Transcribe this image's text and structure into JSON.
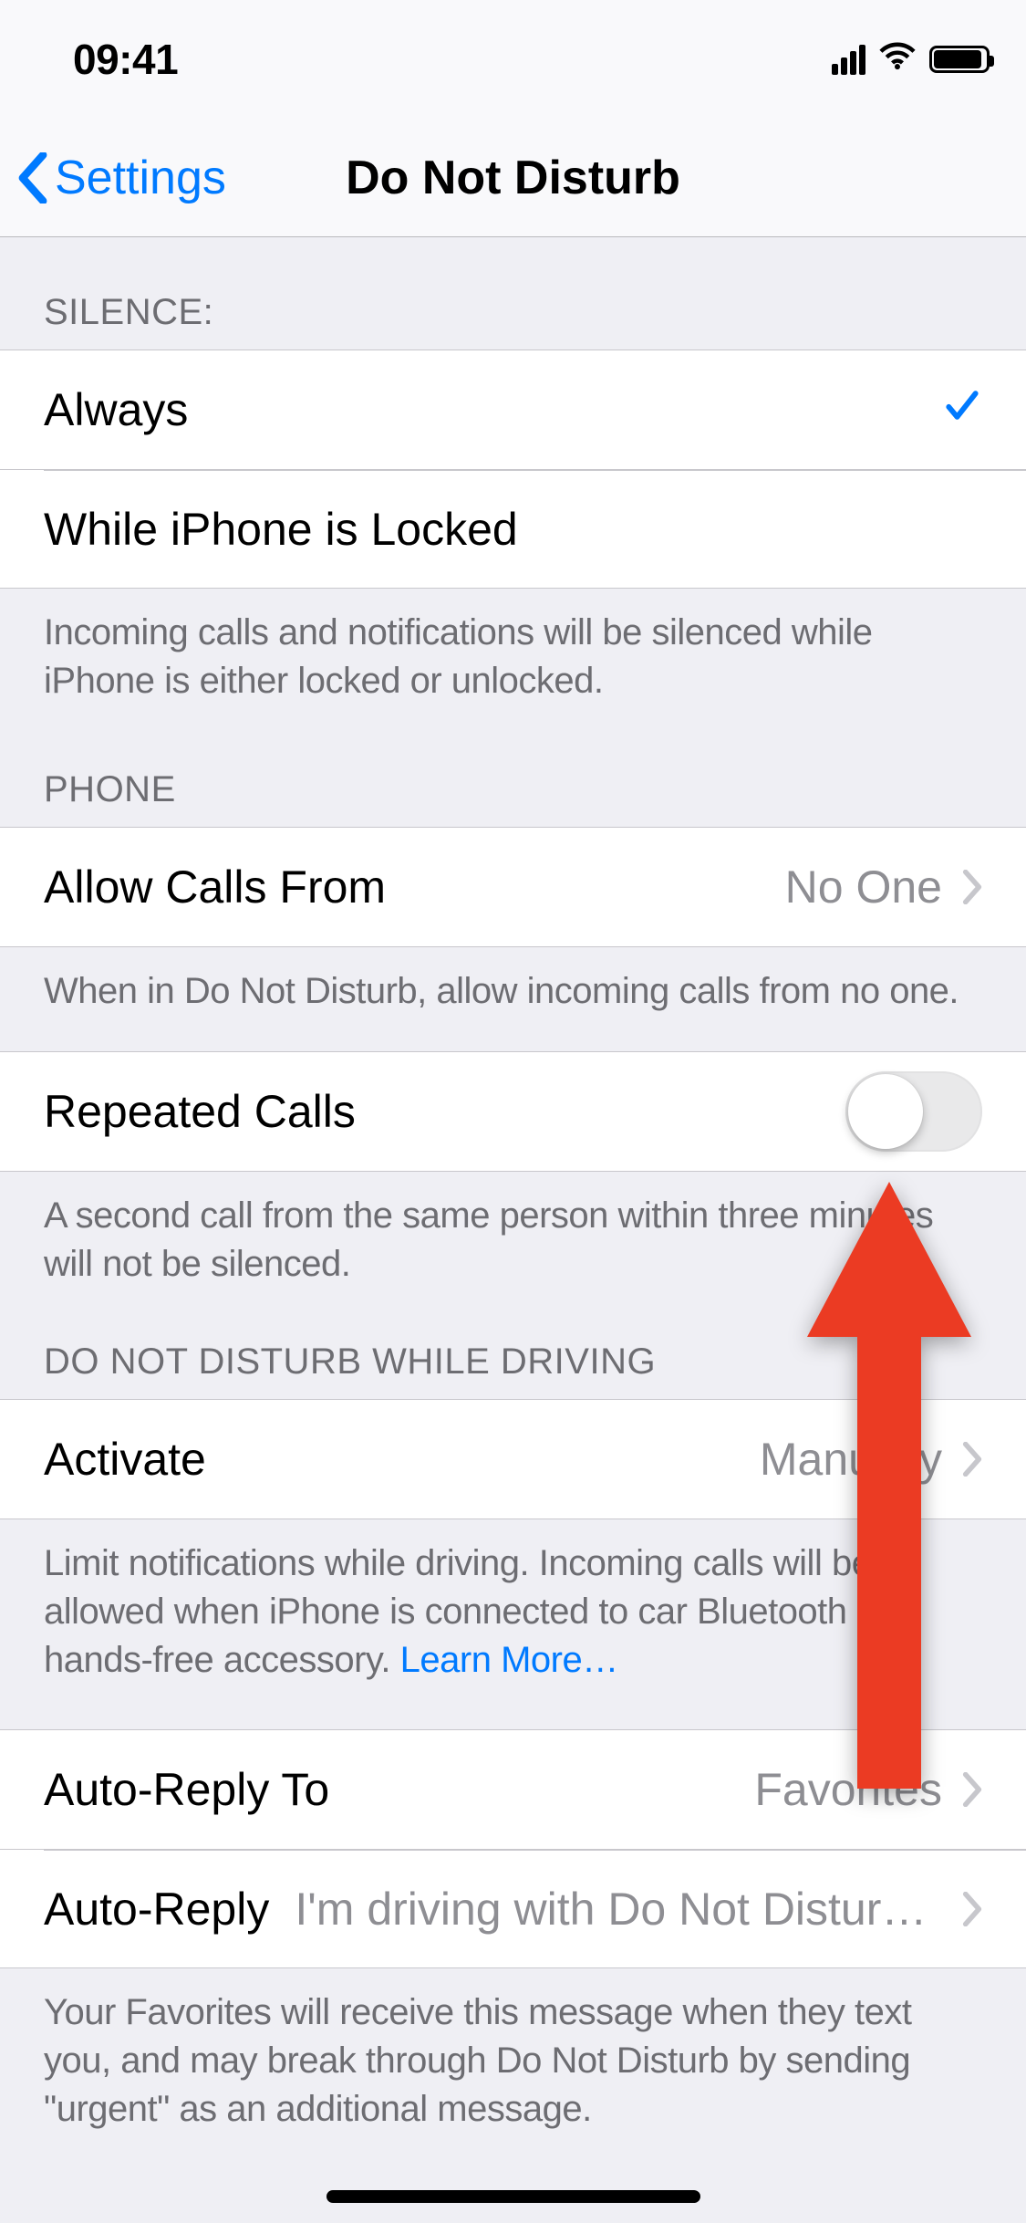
{
  "status": {
    "time": "09:41"
  },
  "nav": {
    "back_label": "Settings",
    "title": "Do Not Disturb"
  },
  "silence": {
    "header": "SILENCE:",
    "always": "Always",
    "while_locked": "While iPhone is Locked",
    "footer": "Incoming calls and notifications will be silenced while iPhone is either locked or unlocked.",
    "selected": "always"
  },
  "phone": {
    "header": "PHONE",
    "allow_calls_label": "Allow Calls From",
    "allow_calls_value": "No One",
    "allow_calls_footer": "When in Do Not Disturb, allow incoming calls from no one.",
    "repeated_calls_label": "Repeated Calls",
    "repeated_calls_on": false,
    "repeated_calls_footer": "A second call from the same person within three minutes will not be silenced."
  },
  "driving": {
    "header": "DO NOT DISTURB WHILE DRIVING",
    "activate_label": "Activate",
    "activate_value": "Manually",
    "activate_footer_text": "Limit notifications while driving. Incoming calls will be allowed when iPhone is connected to car Bluetooth or hands-free accessory. ",
    "learn_more": "Learn More…",
    "auto_reply_to_label": "Auto-Reply To",
    "auto_reply_to_value": "Favorites",
    "auto_reply_label": "Auto-Reply",
    "auto_reply_value": "I'm driving with Do Not Disturb Whil…",
    "auto_reply_footer": "Your Favorites will receive this message when they text you, and may break through Do Not Disturb by sending \"urgent\" as an additional message."
  },
  "annotation": {
    "arrow_color": "#eb3b23"
  }
}
